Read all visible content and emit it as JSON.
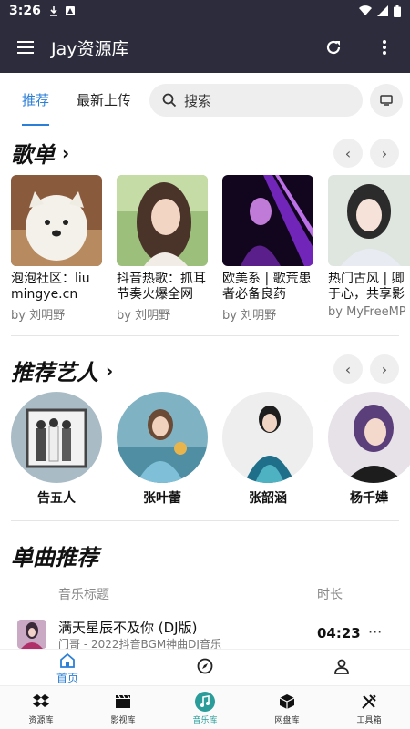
{
  "status": {
    "time": "3:26"
  },
  "appbar": {
    "title": "Jay资源库"
  },
  "tabs": [
    {
      "label": "推荐"
    },
    {
      "label": "最新上传"
    }
  ],
  "search": {
    "placeholder": "搜索"
  },
  "playlists_section": {
    "title": "歌单",
    "items": [
      {
        "title": "泡泡社区：liumingye.cn",
        "by": "by 刘明野"
      },
      {
        "title": "抖音热歌：抓耳节奏火爆全网",
        "by": "by 刘明野"
      },
      {
        "title": "欧美系 | 歌荒患者必备良药",
        "by": "by 刘明野"
      },
      {
        "title": "热门古风 | 卿于心，共享影",
        "by": "by MyFreeMP"
      }
    ]
  },
  "artists_section": {
    "title": "推荐艺人",
    "items": [
      {
        "name": "告五人"
      },
      {
        "name": "张叶蕾"
      },
      {
        "name": "张韶涵"
      },
      {
        "name": "杨千嬅"
      }
    ]
  },
  "singles_section": {
    "title": "单曲推荐",
    "col_title": "音乐标题",
    "col_duration": "时长",
    "songs": [
      {
        "title": "满天星辰不及你 (DJ版)",
        "subtitle": "门哥 - 2022抖音BGM神曲DJ音乐",
        "duration": "04:23"
      }
    ]
  },
  "inner_nav": {
    "home": "首页"
  },
  "bottom_nav": [
    {
      "label": "资源库",
      "icon": "dropbox-icon"
    },
    {
      "label": "影视库",
      "icon": "clapper-icon"
    },
    {
      "label": "音乐库",
      "icon": "music-icon",
      "active": true
    },
    {
      "label": "网盘库",
      "icon": "box-icon"
    },
    {
      "label": "工具箱",
      "icon": "tools-icon"
    }
  ],
  "colors": {
    "accent": "#2b7fd6",
    "appbar": "#2c2c3c",
    "music_active": "#2a9d9a"
  }
}
